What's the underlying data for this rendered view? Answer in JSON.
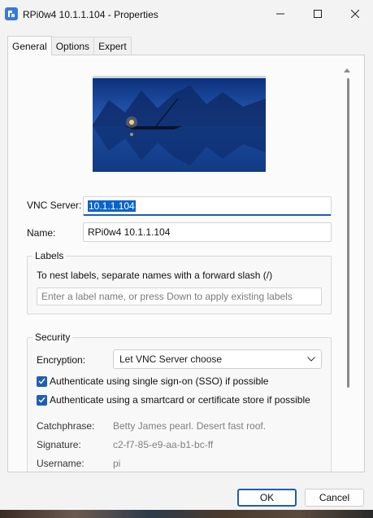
{
  "window": {
    "title": "RPi0w4 10.1.1.104 - Properties",
    "icon": "vnc-viewer-icon"
  },
  "tabs": [
    {
      "label": "General",
      "active": true
    },
    {
      "label": "Options",
      "active": false
    },
    {
      "label": "Expert",
      "active": false
    }
  ],
  "general": {
    "vnc_server_label": "VNC Server:",
    "vnc_server_value": "10.1.1.104",
    "name_label": "Name:",
    "name_value": "RPi0w4 10.1.1.104"
  },
  "labels": {
    "title": "Labels",
    "help": "To nest labels, separate names with a forward slash (/)",
    "placeholder": "Enter a label name, or press Down to apply existing labels"
  },
  "security": {
    "title": "Security",
    "encryption_label": "Encryption:",
    "encryption_value": "Let VNC Server choose",
    "sso_label": "Authenticate using single sign-on (SSO) if possible",
    "sso_checked": true,
    "smartcard_label": "Authenticate using a smartcard or certificate store if possible",
    "smartcard_checked": true,
    "catchphrase_label": "Catchphrase:",
    "catchphrase_value": "Betty James pearl. Desert fast roof.",
    "signature_label": "Signature:",
    "signature_value": "c2-f7-85-e9-aa-b1-bc-ff",
    "username_label": "Username:",
    "username_value": "pi"
  },
  "buttons": {
    "ok": "OK",
    "cancel": "Cancel"
  },
  "colors": {
    "accent": "#1f5fb0",
    "window_bg": "#f3f3f3",
    "panel_bg": "#fbfbfb"
  }
}
